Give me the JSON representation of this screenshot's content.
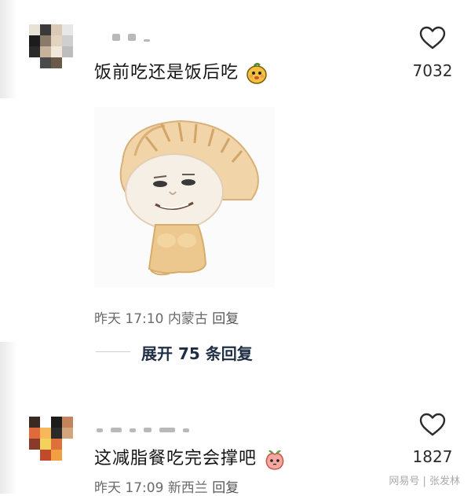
{
  "comments": [
    {
      "text": "饭前吃还是饭后吃",
      "emoji": "mango-face-icon",
      "likes": "7032",
      "sticker": "dumpling-character-sticker",
      "meta": {
        "time": "昨天 17:10",
        "location": "内蒙古",
        "reply": "回复"
      },
      "expand": {
        "label": "展开 75 条回复"
      }
    },
    {
      "text": "这减脂餐吃完会撑吧",
      "emoji": "peach-face-icon",
      "likes": "1827",
      "meta": {
        "time": "昨天 17:09",
        "location": "新西兰",
        "reply": "回复"
      }
    }
  ],
  "watermark": {
    "source": "网易号",
    "author": "张发林"
  },
  "colors": {
    "like": "#2b2b2b",
    "meta": "#6b6b6b",
    "expand": "#1f2e44"
  }
}
